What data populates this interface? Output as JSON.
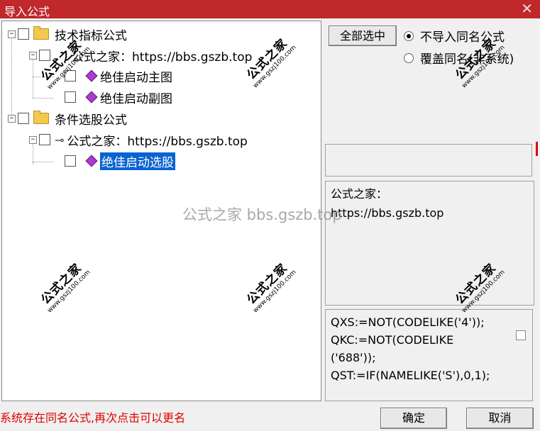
{
  "window": {
    "title": "导入公式",
    "close_glyph": "✕"
  },
  "tree": {
    "expander_glyph": "−",
    "root1": {
      "label": "技术指标公式"
    },
    "child1": {
      "label": "公式之家：https://bbs.gszb.top"
    },
    "leaf1": {
      "label": "绝佳启动主图"
    },
    "leaf2": {
      "label": "绝佳启动副图"
    },
    "root2": {
      "label": "条件选股公式"
    },
    "child2": {
      "label": "公式之家：https://bbs.gszb.top",
      "icon_glyph": "⊸"
    },
    "leaf3": {
      "label": "绝佳启动选股"
    }
  },
  "buttons": {
    "select_all": "全部选中",
    "ok": "确定",
    "cancel": "取消"
  },
  "options": {
    "radio1": {
      "label": "不导入同名公式",
      "checked": true
    },
    "radio2": {
      "label": "覆盖同名(非系统)",
      "checked": false
    }
  },
  "description": {
    "line1": "公式之家：",
    "line2": "https://bbs.gszb.top"
  },
  "code": {
    "text": "QXS:=NOT(CODELIKE('4'));\nQKC:=NOT(CODELIKE\n('688'));\nQST:=IF(NAMELIKE('S'),0,1);"
  },
  "status": {
    "text": "系统存在同名公式,再次点击可以更名"
  },
  "watermark": {
    "center": "公式之家 bbs.gszb.top",
    "stamp_big": "公式之家",
    "stamp_small": "www.gszj100.com"
  },
  "colors": {
    "titlebar": "#c0282c",
    "selection": "#0a64d0",
    "status": "#e00000"
  }
}
